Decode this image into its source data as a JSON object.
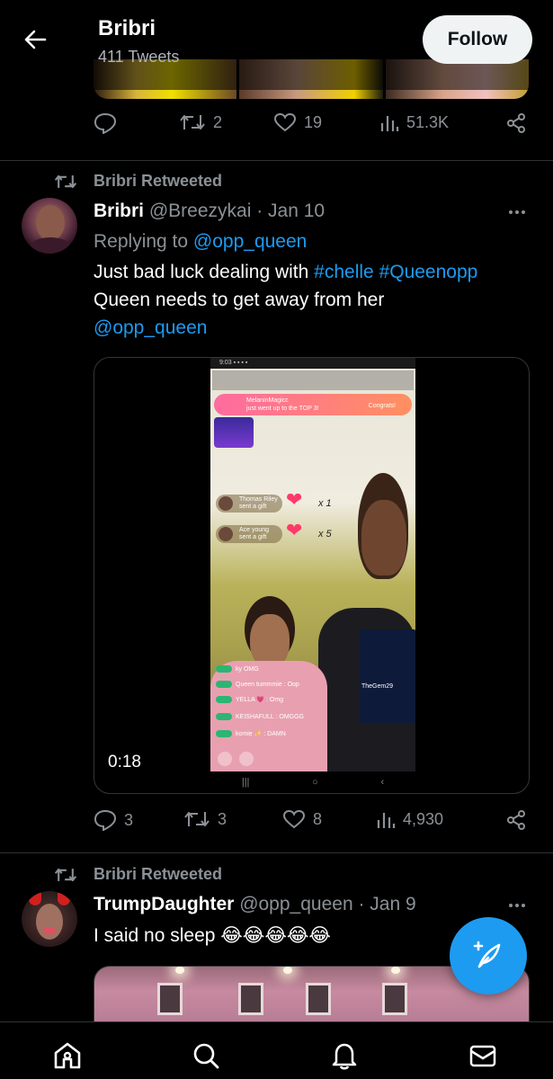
{
  "header": {
    "back_icon": "arrow-left-icon",
    "name": "Bribri",
    "tweet_count": "411 Tweets",
    "follow_label": "Follow"
  },
  "tweet0_actions": {
    "reply_count": "",
    "retweet_count": "2",
    "like_count": "19",
    "view_count": "51.3K"
  },
  "tweet1": {
    "retweeted_by": "Bribri Retweeted",
    "name": "Bribri",
    "handle": "@Breezykai",
    "date": "· Jan 10",
    "replying_prefix": "Replying to",
    "replying_handle": "@opp_queen",
    "text_line1_plain": "Just bad luck dealing with",
    "hashtag1": "#chelle",
    "hashtag2": "#Queenopp",
    "text_line2": "Queen needs to get away from her",
    "mention": "@opp_queen",
    "video": {
      "duration": "0:18",
      "banner_user": "MelaninMagicc",
      "banner_text": "just went up to the TOP 3!",
      "banner_action": "Congrats!",
      "gift1_user": "Thomas Riley",
      "gift1_sub": "sent a gift",
      "gift1_count": "x 1",
      "gift2_user": "Ace young",
      "gift2_sub": "sent a gift",
      "gift2_count": "x 5",
      "pip_name": "TheGem29",
      "chat": [
        "ky OMG",
        "Queen tummmie : Oop",
        "YELLA 💗 : Omg",
        "KEISHAFULL : OMGGG",
        "komie ✨ : DAMN"
      ]
    },
    "reply_count": "3",
    "retweet_count": "3",
    "like_count": "8",
    "view_count": "4,930"
  },
  "tweet2": {
    "retweeted_by": "Bribri Retweeted",
    "name": "TrumpDaughter",
    "handle": "@opp_queen",
    "date": "· Jan 9",
    "text": "I said no sleep 😂😂😂😂😂"
  },
  "fab": {
    "icon": "compose-feather-icon"
  },
  "bottom_nav": [
    "home-icon",
    "search-icon",
    "notifications-icon",
    "messages-icon"
  ],
  "colors": {
    "accent": "#1d9bf0",
    "background": "#000000",
    "secondary_text": "#8b9196"
  }
}
